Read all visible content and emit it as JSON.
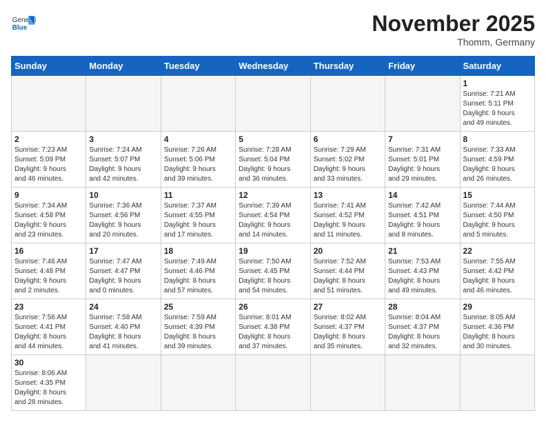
{
  "header": {
    "logo_general": "General",
    "logo_blue": "Blue",
    "month_title": "November 2025",
    "subtitle": "Thomm, Germany"
  },
  "weekdays": [
    "Sunday",
    "Monday",
    "Tuesday",
    "Wednesday",
    "Thursday",
    "Friday",
    "Saturday"
  ],
  "weeks": [
    [
      {
        "day": "",
        "info": ""
      },
      {
        "day": "",
        "info": ""
      },
      {
        "day": "",
        "info": ""
      },
      {
        "day": "",
        "info": ""
      },
      {
        "day": "",
        "info": ""
      },
      {
        "day": "",
        "info": ""
      },
      {
        "day": "1",
        "info": "Sunrise: 7:21 AM\nSunset: 5:11 PM\nDaylight: 9 hours\nand 49 minutes."
      }
    ],
    [
      {
        "day": "2",
        "info": "Sunrise: 7:23 AM\nSunset: 5:09 PM\nDaylight: 9 hours\nand 46 minutes."
      },
      {
        "day": "3",
        "info": "Sunrise: 7:24 AM\nSunset: 5:07 PM\nDaylight: 9 hours\nand 42 minutes."
      },
      {
        "day": "4",
        "info": "Sunrise: 7:26 AM\nSunset: 5:06 PM\nDaylight: 9 hours\nand 39 minutes."
      },
      {
        "day": "5",
        "info": "Sunrise: 7:28 AM\nSunset: 5:04 PM\nDaylight: 9 hours\nand 36 minutes."
      },
      {
        "day": "6",
        "info": "Sunrise: 7:29 AM\nSunset: 5:02 PM\nDaylight: 9 hours\nand 33 minutes."
      },
      {
        "day": "7",
        "info": "Sunrise: 7:31 AM\nSunset: 5:01 PM\nDaylight: 9 hours\nand 29 minutes."
      },
      {
        "day": "8",
        "info": "Sunrise: 7:33 AM\nSunset: 4:59 PM\nDaylight: 9 hours\nand 26 minutes."
      }
    ],
    [
      {
        "day": "9",
        "info": "Sunrise: 7:34 AM\nSunset: 4:58 PM\nDaylight: 9 hours\nand 23 minutes."
      },
      {
        "day": "10",
        "info": "Sunrise: 7:36 AM\nSunset: 4:56 PM\nDaylight: 9 hours\nand 20 minutes."
      },
      {
        "day": "11",
        "info": "Sunrise: 7:37 AM\nSunset: 4:55 PM\nDaylight: 9 hours\nand 17 minutes."
      },
      {
        "day": "12",
        "info": "Sunrise: 7:39 AM\nSunset: 4:54 PM\nDaylight: 9 hours\nand 14 minutes."
      },
      {
        "day": "13",
        "info": "Sunrise: 7:41 AM\nSunset: 4:52 PM\nDaylight: 9 hours\nand 11 minutes."
      },
      {
        "day": "14",
        "info": "Sunrise: 7:42 AM\nSunset: 4:51 PM\nDaylight: 9 hours\nand 8 minutes."
      },
      {
        "day": "15",
        "info": "Sunrise: 7:44 AM\nSunset: 4:50 PM\nDaylight: 9 hours\nand 5 minutes."
      }
    ],
    [
      {
        "day": "16",
        "info": "Sunrise: 7:46 AM\nSunset: 4:48 PM\nDaylight: 9 hours\nand 2 minutes."
      },
      {
        "day": "17",
        "info": "Sunrise: 7:47 AM\nSunset: 4:47 PM\nDaylight: 9 hours\nand 0 minutes."
      },
      {
        "day": "18",
        "info": "Sunrise: 7:49 AM\nSunset: 4:46 PM\nDaylight: 8 hours\nand 57 minutes."
      },
      {
        "day": "19",
        "info": "Sunrise: 7:50 AM\nSunset: 4:45 PM\nDaylight: 8 hours\nand 54 minutes."
      },
      {
        "day": "20",
        "info": "Sunrise: 7:52 AM\nSunset: 4:44 PM\nDaylight: 8 hours\nand 51 minutes."
      },
      {
        "day": "21",
        "info": "Sunrise: 7:53 AM\nSunset: 4:43 PM\nDaylight: 8 hours\nand 49 minutes."
      },
      {
        "day": "22",
        "info": "Sunrise: 7:55 AM\nSunset: 4:42 PM\nDaylight: 8 hours\nand 46 minutes."
      }
    ],
    [
      {
        "day": "23",
        "info": "Sunrise: 7:56 AM\nSunset: 4:41 PM\nDaylight: 8 hours\nand 44 minutes."
      },
      {
        "day": "24",
        "info": "Sunrise: 7:58 AM\nSunset: 4:40 PM\nDaylight: 8 hours\nand 41 minutes."
      },
      {
        "day": "25",
        "info": "Sunrise: 7:59 AM\nSunset: 4:39 PM\nDaylight: 8 hours\nand 39 minutes."
      },
      {
        "day": "26",
        "info": "Sunrise: 8:01 AM\nSunset: 4:38 PM\nDaylight: 8 hours\nand 37 minutes."
      },
      {
        "day": "27",
        "info": "Sunrise: 8:02 AM\nSunset: 4:37 PM\nDaylight: 8 hours\nand 35 minutes."
      },
      {
        "day": "28",
        "info": "Sunrise: 8:04 AM\nSunset: 4:37 PM\nDaylight: 8 hours\nand 32 minutes."
      },
      {
        "day": "29",
        "info": "Sunrise: 8:05 AM\nSunset: 4:36 PM\nDaylight: 8 hours\nand 30 minutes."
      }
    ],
    [
      {
        "day": "30",
        "info": "Sunrise: 8:06 AM\nSunset: 4:35 PM\nDaylight: 8 hours\nand 28 minutes."
      },
      {
        "day": "",
        "info": ""
      },
      {
        "day": "",
        "info": ""
      },
      {
        "day": "",
        "info": ""
      },
      {
        "day": "",
        "info": ""
      },
      {
        "day": "",
        "info": ""
      },
      {
        "day": "",
        "info": ""
      }
    ]
  ]
}
